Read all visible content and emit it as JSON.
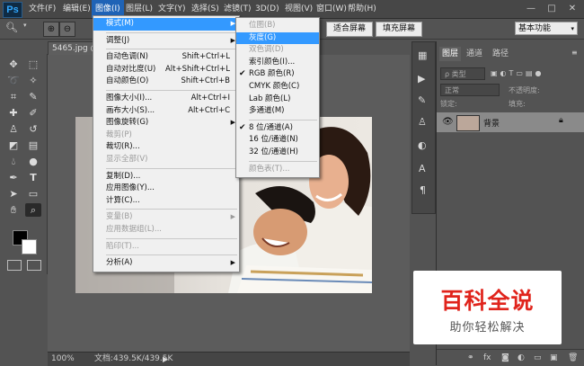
{
  "app": {
    "logo": "Ps"
  },
  "menubar": {
    "items": [
      "文件(F)",
      "编辑(E)",
      "图像(I)",
      "图层(L)",
      "文字(Y)",
      "选择(S)",
      "滤镜(T)",
      "3D(D)",
      "视图(V)",
      "窗口(W)",
      "帮助(H)"
    ],
    "active_index": 2
  },
  "options_bar": {
    "fit_screen": "适合屏幕",
    "fill_screen": "填充屏幕",
    "workspace": "基本功能"
  },
  "document": {
    "tab_title": "5465.jpg @",
    "zoom": "100%",
    "doc_info": "文档:439.5K/439.5K"
  },
  "image_menu": {
    "items": [
      {
        "label": "模式(M)",
        "submenu": true,
        "highlight": true
      },
      {
        "sep": true
      },
      {
        "label": "调整(J)",
        "submenu": true
      },
      {
        "sep": true
      },
      {
        "label": "自动色调(N)",
        "shortcut": "Shift+Ctrl+L"
      },
      {
        "label": "自动对比度(U)",
        "shortcut": "Alt+Shift+Ctrl+L"
      },
      {
        "label": "自动颜色(O)",
        "shortcut": "Shift+Ctrl+B"
      },
      {
        "sep": true
      },
      {
        "label": "图像大小(I)...",
        "shortcut": "Alt+Ctrl+I"
      },
      {
        "label": "画布大小(S)...",
        "shortcut": "Alt+Ctrl+C"
      },
      {
        "label": "图像旋转(G)",
        "submenu": true
      },
      {
        "label": "裁剪(P)",
        "disabled": true
      },
      {
        "label": "裁切(R)..."
      },
      {
        "label": "显示全部(V)",
        "disabled": true
      },
      {
        "sep": true
      },
      {
        "label": "复制(D)..."
      },
      {
        "label": "应用图像(Y)..."
      },
      {
        "label": "计算(C)..."
      },
      {
        "sep": true
      },
      {
        "label": "变量(B)",
        "submenu": true,
        "disabled": true
      },
      {
        "label": "应用数据组(L)...",
        "disabled": true
      },
      {
        "sep": true
      },
      {
        "label": "陷印(T)...",
        "disabled": true
      },
      {
        "sep": true
      },
      {
        "label": "分析(A)",
        "submenu": true
      }
    ]
  },
  "mode_submenu": {
    "items": [
      {
        "label": "位图(B)",
        "disabled": true
      },
      {
        "label": "灰度(G)",
        "highlight": true
      },
      {
        "label": "双色调(D)",
        "disabled": true
      },
      {
        "label": "索引颜色(I)..."
      },
      {
        "label": "RGB 颜色(R)",
        "checked": true
      },
      {
        "label": "CMYK 颜色(C)"
      },
      {
        "label": "Lab 颜色(L)"
      },
      {
        "label": "多通道(M)"
      },
      {
        "sep": true
      },
      {
        "label": "8 位/通道(A)",
        "checked": true
      },
      {
        "label": "16 位/通道(N)"
      },
      {
        "label": "32 位/通道(H)"
      },
      {
        "sep": true
      },
      {
        "label": "颜色表(T)...",
        "disabled": true
      }
    ]
  },
  "layers_panel": {
    "tabs": [
      "图层",
      "通道",
      "路径"
    ],
    "filter_label": "ρ 类型",
    "blend_mode": "正常",
    "opacity_label": "不透明度:",
    "lock_label": "锁定:",
    "fill_label": "填充:",
    "layer_name": "背景"
  },
  "watermark": {
    "title": "百科全说",
    "subtitle": "助你轻松解决"
  },
  "colors": {
    "accent": "#3399ff",
    "menubar_active": "#1f63b6",
    "watermark_red": "#e0241c"
  }
}
